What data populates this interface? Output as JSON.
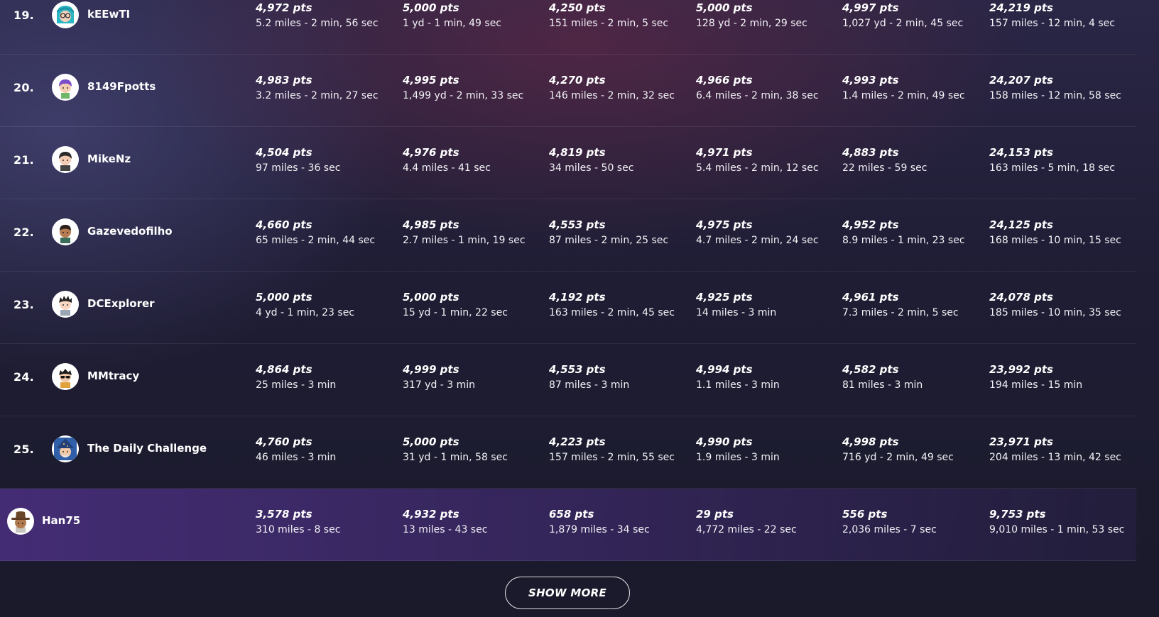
{
  "leaderboard": {
    "rows": [
      {
        "rank": "19.",
        "name": "kEEwTI",
        "avatar_icon": "teal-hair-glasses-avatar-icon",
        "rounds": [
          {
            "pts": "4,972 pts",
            "detail": "5.2 miles - 2 min, 56 sec"
          },
          {
            "pts": "5,000 pts",
            "detail": "1 yd - 1 min, 49 sec"
          },
          {
            "pts": "4,250 pts",
            "detail": "151 miles - 2 min, 5 sec"
          },
          {
            "pts": "5,000 pts",
            "detail": "128 yd - 2 min, 29 sec"
          },
          {
            "pts": "4,997 pts",
            "detail": "1,027 yd - 2 min, 45 sec"
          },
          {
            "pts": "24,219 pts",
            "detail": "157 miles - 12 min, 4 sec"
          }
        ]
      },
      {
        "rank": "20.",
        "name": "8149Fpotts",
        "avatar_icon": "purple-hair-avatar-icon",
        "rounds": [
          {
            "pts": "4,983 pts",
            "detail": "3.2 miles - 2 min, 27 sec"
          },
          {
            "pts": "4,995 pts",
            "detail": "1,499 yd - 2 min, 33 sec"
          },
          {
            "pts": "4,270 pts",
            "detail": "146 miles - 2 min, 32 sec"
          },
          {
            "pts": "4,966 pts",
            "detail": "6.4 miles - 2 min, 38 sec"
          },
          {
            "pts": "4,993 pts",
            "detail": "1.4 miles - 2 min, 49 sec"
          },
          {
            "pts": "24,207 pts",
            "detail": "158 miles - 12 min, 58 sec"
          }
        ]
      },
      {
        "rank": "21.",
        "name": "MikeNz",
        "avatar_icon": "dark-hair-avatar-icon",
        "rounds": [
          {
            "pts": "4,504 pts",
            "detail": "97 miles - 36 sec"
          },
          {
            "pts": "4,976 pts",
            "detail": "4.4 miles - 41 sec"
          },
          {
            "pts": "4,819 pts",
            "detail": "34 miles - 50 sec"
          },
          {
            "pts": "4,971 pts",
            "detail": "5.4 miles - 2 min, 12 sec"
          },
          {
            "pts": "4,883 pts",
            "detail": "22 miles - 59 sec"
          },
          {
            "pts": "24,153 pts",
            "detail": "163 miles - 5 min, 18 sec"
          }
        ]
      },
      {
        "rank": "22.",
        "name": "Gazevedofilho",
        "avatar_icon": "tan-skin-avatar-icon",
        "rounds": [
          {
            "pts": "4,660 pts",
            "detail": "65 miles - 2 min, 44 sec"
          },
          {
            "pts": "4,985 pts",
            "detail": "2.7 miles - 1 min, 19 sec"
          },
          {
            "pts": "4,553 pts",
            "detail": "87 miles - 2 min, 25 sec"
          },
          {
            "pts": "4,975 pts",
            "detail": "4.7 miles - 2 min, 24 sec"
          },
          {
            "pts": "4,952 pts",
            "detail": "8.9 miles - 1 min, 23 sec"
          },
          {
            "pts": "24,125 pts",
            "detail": "168 miles - 10 min, 15 sec"
          }
        ]
      },
      {
        "rank": "23.",
        "name": "DCExplorer",
        "avatar_icon": "spiky-hair-avatar-icon",
        "rounds": [
          {
            "pts": "5,000 pts",
            "detail": "4 yd - 1 min, 23 sec"
          },
          {
            "pts": "5,000 pts",
            "detail": "15 yd - 1 min, 22 sec"
          },
          {
            "pts": "4,192 pts",
            "detail": "163 miles - 2 min, 45 sec"
          },
          {
            "pts": "4,925 pts",
            "detail": "14 miles - 3 min"
          },
          {
            "pts": "4,961 pts",
            "detail": "7.3 miles - 2 min, 5 sec"
          },
          {
            "pts": "24,078 pts",
            "detail": "185 miles - 10 min, 35 sec"
          }
        ]
      },
      {
        "rank": "24.",
        "name": "MMtracy",
        "avatar_icon": "sunglasses-avatar-icon",
        "rounds": [
          {
            "pts": "4,864 pts",
            "detail": "25 miles - 3 min"
          },
          {
            "pts": "4,999 pts",
            "detail": "317 yd - 3 min"
          },
          {
            "pts": "4,553 pts",
            "detail": "87 miles - 3 min"
          },
          {
            "pts": "4,994 pts",
            "detail": "1.1 miles - 3 min"
          },
          {
            "pts": "4,582 pts",
            "detail": "81 miles - 3 min"
          },
          {
            "pts": "23,992 pts",
            "detail": "194 miles - 15 min"
          }
        ]
      },
      {
        "rank": "25.",
        "name": "The Daily Challenge",
        "avatar_icon": "wizard-hat-avatar-icon",
        "rounds": [
          {
            "pts": "4,760 pts",
            "detail": "46 miles - 3 min"
          },
          {
            "pts": "5,000 pts",
            "detail": "31 yd - 1 min, 58 sec"
          },
          {
            "pts": "4,223 pts",
            "detail": "157 miles - 2 min, 55 sec"
          },
          {
            "pts": "4,990 pts",
            "detail": "1.9 miles - 3 min"
          },
          {
            "pts": "4,998 pts",
            "detail": "716 yd - 2 min, 49 sec"
          },
          {
            "pts": "23,971 pts",
            "detail": "204 miles - 13 min, 42 sec"
          }
        ]
      }
    ],
    "current_user": {
      "name": "Han75",
      "avatar_icon": "cowboy-hat-avatar-icon",
      "rounds": [
        {
          "pts": "3,578 pts",
          "detail": "310 miles - 8 sec"
        },
        {
          "pts": "4,932 pts",
          "detail": "13 miles - 43 sec"
        },
        {
          "pts": "658 pts",
          "detail": "1,879 miles - 34 sec"
        },
        {
          "pts": "29 pts",
          "detail": "4,772 miles - 22 sec"
        },
        {
          "pts": "556 pts",
          "detail": "2,036 miles - 7 sec"
        },
        {
          "pts": "9,753 pts",
          "detail": "9,010 miles - 1 min, 53 sec"
        }
      ]
    }
  },
  "show_more_label": "SHOW MORE",
  "colors": {
    "background": "#1c1b2e",
    "highlight_row": "#4a2f7a",
    "text": "#ffffff"
  }
}
